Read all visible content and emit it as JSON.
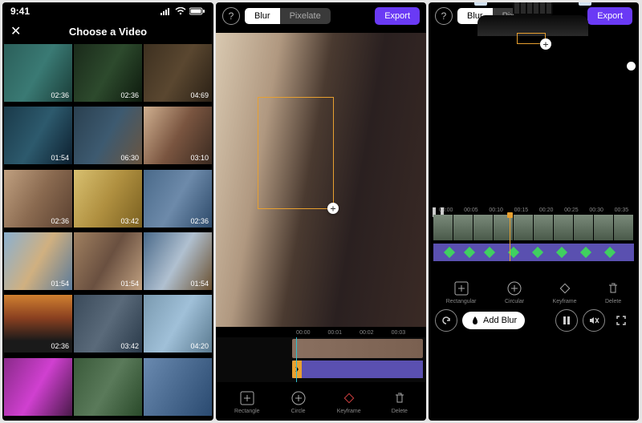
{
  "screen1": {
    "status_time": "9:41",
    "title": "Choose a Video",
    "videos": [
      {
        "dur": "02:36"
      },
      {
        "dur": "02:36"
      },
      {
        "dur": "04:69"
      },
      {
        "dur": "01:54"
      },
      {
        "dur": "06:30"
      },
      {
        "dur": "03:10"
      },
      {
        "dur": "02:36"
      },
      {
        "dur": "03:42"
      },
      {
        "dur": "02:36"
      },
      {
        "dur": "01:54"
      },
      {
        "dur": "01:54"
      },
      {
        "dur": "01:54"
      },
      {
        "dur": "02:36"
      },
      {
        "dur": "03:42"
      },
      {
        "dur": "04:20"
      },
      {
        "dur": ""
      },
      {
        "dur": ""
      },
      {
        "dur": ""
      }
    ]
  },
  "screen2": {
    "seg_blur": "Blur",
    "seg_pixelate": "Pixelate",
    "export": "Export",
    "ruler": [
      "00:00",
      "00:01",
      "00:02",
      "00:03"
    ],
    "tools": {
      "rectangle": "Rectangle",
      "circle": "Circle",
      "keyframe": "Keyframe",
      "delete": "Delete"
    }
  },
  "screen3": {
    "seg_blur": "Blur",
    "seg_pixelate": "Pixelate",
    "export": "Export",
    "ruler": [
      "00:00",
      "00:05",
      "00:10",
      "00:15",
      "00:20",
      "00:25",
      "00:30",
      "00:35"
    ],
    "tools": {
      "rectangle": "Rectangular",
      "circle": "Circular",
      "keyframe": "Keyframe",
      "delete": "Delete"
    },
    "add_blur": "Add Blur"
  }
}
